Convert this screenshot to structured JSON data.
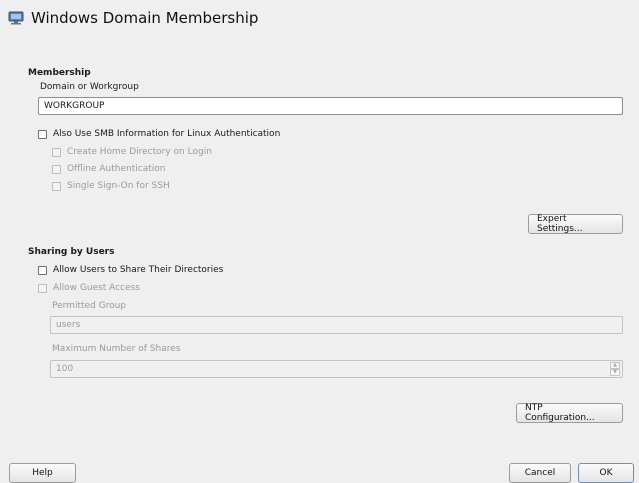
{
  "window": {
    "title": "Windows Domain Membership",
    "icon": "computer-network-icon"
  },
  "membership": {
    "section_label": "Membership",
    "domain_label": "Domain or Workgroup",
    "domain_value": "WORKGROUP",
    "smb_auth_label": "Also Use SMB Information for Linux Authentication",
    "smb_auth_checked": false,
    "create_home_label": "Create Home Directory on Login",
    "offline_auth_label": "Offline Authentication",
    "sso_ssh_label": "Single Sign-On for SSH",
    "expert_settings_label": "Expert Settings..."
  },
  "sharing": {
    "section_label": "Sharing by Users",
    "allow_share_label": "Allow Users to Share Their Directories",
    "allow_share_checked": false,
    "allow_guest_label": "Allow Guest Access",
    "permitted_group_label": "Permitted Group",
    "permitted_group_value": "users",
    "max_shares_label": "Maximum Number of Shares",
    "max_shares_value": "100",
    "ntp_label": "NTP Configuration..."
  },
  "footer": {
    "help_label": "Help",
    "cancel_label": "Cancel",
    "ok_label": "OK"
  },
  "colors": {
    "background": "#efefef",
    "ok_border": "#6f8fb8",
    "disabled_text": "#9a9a9a"
  }
}
